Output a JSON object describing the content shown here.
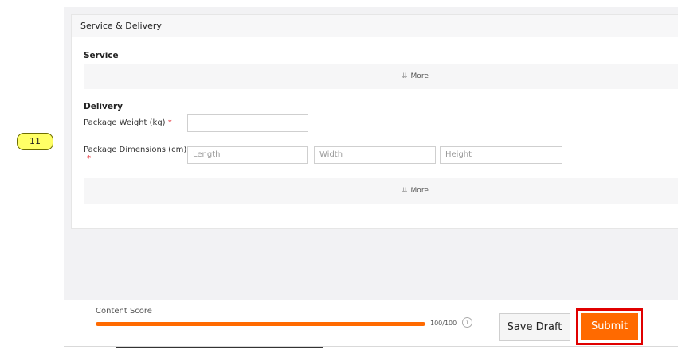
{
  "annotation": {
    "badge_number": "11",
    "badge_color": "#ffff66",
    "highlight_color": "#e00000"
  },
  "section": {
    "header": "Service & Delivery",
    "service": {
      "title": "Service",
      "more_label": "More",
      "more_icon": "double-chevron-down-icon"
    },
    "delivery": {
      "title": "Delivery",
      "weight_label": "Package Weight (kg)",
      "weight_value": "",
      "dimensions_label": "Package Dimensions (cm)",
      "required_marker": "*",
      "length_placeholder": "Length",
      "width_placeholder": "Width",
      "height_placeholder": "Height",
      "more_label": "More",
      "more_icon": "double-chevron-down-icon"
    }
  },
  "footer": {
    "score_label": "Content Score",
    "score_value": 100,
    "score_max": 100,
    "score_text": "100/100",
    "score_color": "#ff6a00",
    "info_icon": "info-circle-icon",
    "save_draft_label": "Save Draft",
    "submit_label": "Submit",
    "submit_color": "#ff6a00"
  }
}
